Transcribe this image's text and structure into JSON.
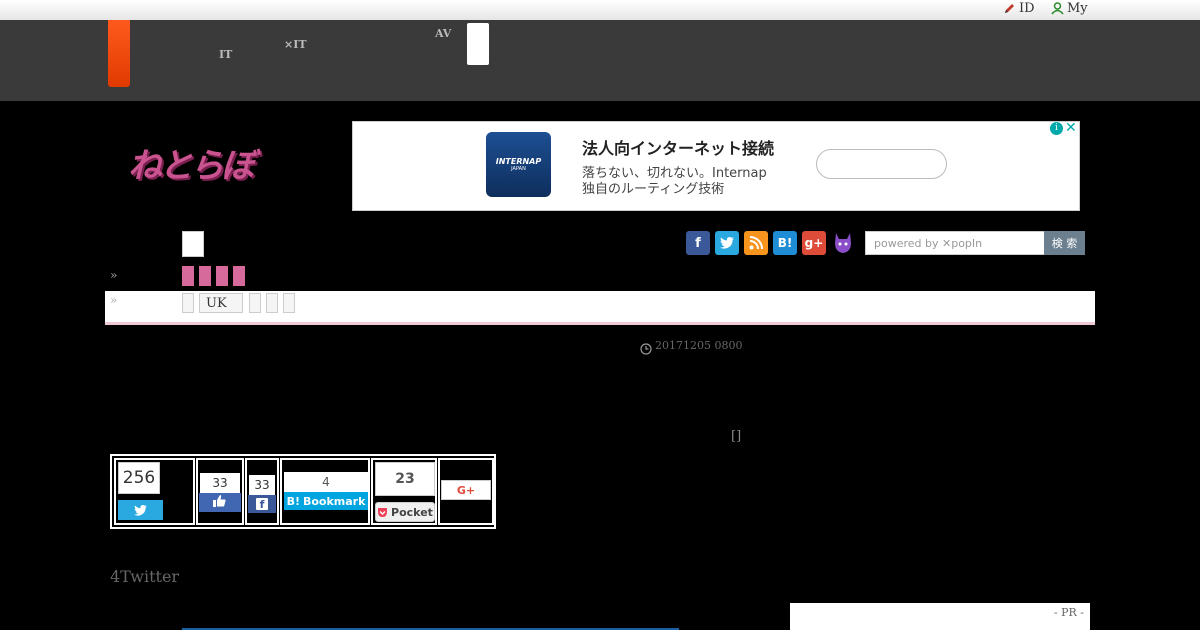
{
  "topbar": {
    "id_label": "ID",
    "my_label": "My"
  },
  "nav": {
    "item1_line1": "　　",
    "item1_line2": "IT",
    "item2_line1": "　　　",
    "item2_line2": "×IT",
    "item3_line1": "AV",
    "item3_line2": "　　"
  },
  "brand": {
    "logo_text": "ねとらぼ"
  },
  "ad": {
    "title": "法人向インターネット接続",
    "line1": "落ちない、切れない。Internap",
    "line2": "独自のルーティング技術",
    "logo_text": "INTERNAP",
    "logo_sub": "JAPAN"
  },
  "search": {
    "placeholder": "powered by ✕popIn",
    "button_label": "検 索"
  },
  "breadcrumbs": {
    "arrow1": "»",
    "arrow2": "»",
    "chip_uk": "UK"
  },
  "article": {
    "timestamp": "20171205 0800",
    "bracket": "[]",
    "heading": "4Twitter"
  },
  "share": {
    "twitter_count": "256",
    "like_count": "33",
    "fb_count": "33",
    "hatena_count": "4",
    "hatena_label": "Bookmark",
    "pocket_count": "23",
    "pocket_label": "Pocket",
    "gplus_label": "G+"
  },
  "pr": {
    "label": "- PR -"
  }
}
